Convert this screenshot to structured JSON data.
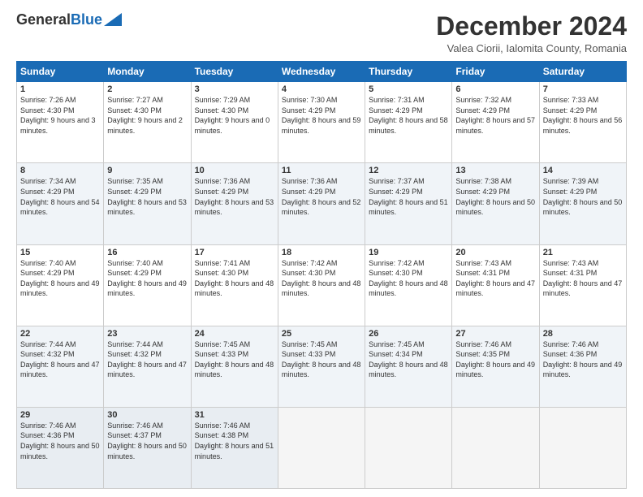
{
  "header": {
    "logo_line1": "General",
    "logo_line2": "Blue",
    "month": "December 2024",
    "location": "Valea Ciorii, Ialomita County, Romania"
  },
  "weekdays": [
    "Sunday",
    "Monday",
    "Tuesday",
    "Wednesday",
    "Thursday",
    "Friday",
    "Saturday"
  ],
  "weeks": [
    [
      {
        "day": "1",
        "sunrise": "7:26 AM",
        "sunset": "4:30 PM",
        "daylight": "9 hours and 3 minutes."
      },
      {
        "day": "2",
        "sunrise": "7:27 AM",
        "sunset": "4:30 PM",
        "daylight": "9 hours and 2 minutes."
      },
      {
        "day": "3",
        "sunrise": "7:29 AM",
        "sunset": "4:30 PM",
        "daylight": "9 hours and 0 minutes."
      },
      {
        "day": "4",
        "sunrise": "7:30 AM",
        "sunset": "4:29 PM",
        "daylight": "8 hours and 59 minutes."
      },
      {
        "day": "5",
        "sunrise": "7:31 AM",
        "sunset": "4:29 PM",
        "daylight": "8 hours and 58 minutes."
      },
      {
        "day": "6",
        "sunrise": "7:32 AM",
        "sunset": "4:29 PM",
        "daylight": "8 hours and 57 minutes."
      },
      {
        "day": "7",
        "sunrise": "7:33 AM",
        "sunset": "4:29 PM",
        "daylight": "8 hours and 56 minutes."
      }
    ],
    [
      {
        "day": "8",
        "sunrise": "7:34 AM",
        "sunset": "4:29 PM",
        "daylight": "8 hours and 54 minutes."
      },
      {
        "day": "9",
        "sunrise": "7:35 AM",
        "sunset": "4:29 PM",
        "daylight": "8 hours and 53 minutes."
      },
      {
        "day": "10",
        "sunrise": "7:36 AM",
        "sunset": "4:29 PM",
        "daylight": "8 hours and 53 minutes."
      },
      {
        "day": "11",
        "sunrise": "7:36 AM",
        "sunset": "4:29 PM",
        "daylight": "8 hours and 52 minutes."
      },
      {
        "day": "12",
        "sunrise": "7:37 AM",
        "sunset": "4:29 PM",
        "daylight": "8 hours and 51 minutes."
      },
      {
        "day": "13",
        "sunrise": "7:38 AM",
        "sunset": "4:29 PM",
        "daylight": "8 hours and 50 minutes."
      },
      {
        "day": "14",
        "sunrise": "7:39 AM",
        "sunset": "4:29 PM",
        "daylight": "8 hours and 50 minutes."
      }
    ],
    [
      {
        "day": "15",
        "sunrise": "7:40 AM",
        "sunset": "4:29 PM",
        "daylight": "8 hours and 49 minutes."
      },
      {
        "day": "16",
        "sunrise": "7:40 AM",
        "sunset": "4:29 PM",
        "daylight": "8 hours and 49 minutes."
      },
      {
        "day": "17",
        "sunrise": "7:41 AM",
        "sunset": "4:30 PM",
        "daylight": "8 hours and 48 minutes."
      },
      {
        "day": "18",
        "sunrise": "7:42 AM",
        "sunset": "4:30 PM",
        "daylight": "8 hours and 48 minutes."
      },
      {
        "day": "19",
        "sunrise": "7:42 AM",
        "sunset": "4:30 PM",
        "daylight": "8 hours and 48 minutes."
      },
      {
        "day": "20",
        "sunrise": "7:43 AM",
        "sunset": "4:31 PM",
        "daylight": "8 hours and 47 minutes."
      },
      {
        "day": "21",
        "sunrise": "7:43 AM",
        "sunset": "4:31 PM",
        "daylight": "8 hours and 47 minutes."
      }
    ],
    [
      {
        "day": "22",
        "sunrise": "7:44 AM",
        "sunset": "4:32 PM",
        "daylight": "8 hours and 47 minutes."
      },
      {
        "day": "23",
        "sunrise": "7:44 AM",
        "sunset": "4:32 PM",
        "daylight": "8 hours and 47 minutes."
      },
      {
        "day": "24",
        "sunrise": "7:45 AM",
        "sunset": "4:33 PM",
        "daylight": "8 hours and 48 minutes."
      },
      {
        "day": "25",
        "sunrise": "7:45 AM",
        "sunset": "4:33 PM",
        "daylight": "8 hours and 48 minutes."
      },
      {
        "day": "26",
        "sunrise": "7:45 AM",
        "sunset": "4:34 PM",
        "daylight": "8 hours and 48 minutes."
      },
      {
        "day": "27",
        "sunrise": "7:46 AM",
        "sunset": "4:35 PM",
        "daylight": "8 hours and 49 minutes."
      },
      {
        "day": "28",
        "sunrise": "7:46 AM",
        "sunset": "4:36 PM",
        "daylight": "8 hours and 49 minutes."
      }
    ],
    [
      {
        "day": "29",
        "sunrise": "7:46 AM",
        "sunset": "4:36 PM",
        "daylight": "8 hours and 50 minutes."
      },
      {
        "day": "30",
        "sunrise": "7:46 AM",
        "sunset": "4:37 PM",
        "daylight": "8 hours and 50 minutes."
      },
      {
        "day": "31",
        "sunrise": "7:46 AM",
        "sunset": "4:38 PM",
        "daylight": "8 hours and 51 minutes."
      },
      null,
      null,
      null,
      null
    ]
  ]
}
